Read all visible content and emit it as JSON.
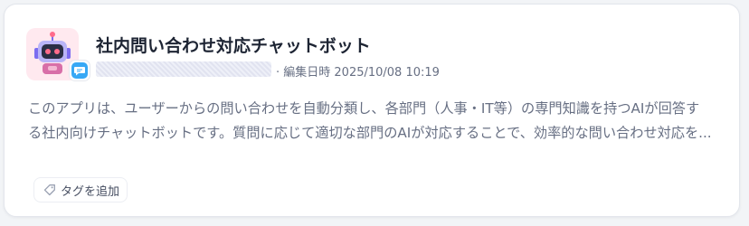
{
  "app": {
    "title": "社内問い合わせ対応チャットボット",
    "meta_text": "· 編集日時 2025/10/08 10:19",
    "description_lines": [
      "このアプリは、ユーザーからの問い合わせを自動分類し、各部門（人事・IT等）の専門知識を持つAIが回答す",
      "る社内向けチャットボットです。質問に応じて適切な部門のAIが対応することで、効率的な問い合わせ対応を..."
    ],
    "icon": "robot-icon",
    "badge_icon": "chat-bubble-icon"
  },
  "tags": {
    "add_label": "タグを追加",
    "icon": "tag-icon"
  },
  "colors": {
    "icon_bg": "#ffe9ef",
    "badge": "#37a8f5",
    "title": "#1d2433",
    "muted_text": "#676f83"
  }
}
